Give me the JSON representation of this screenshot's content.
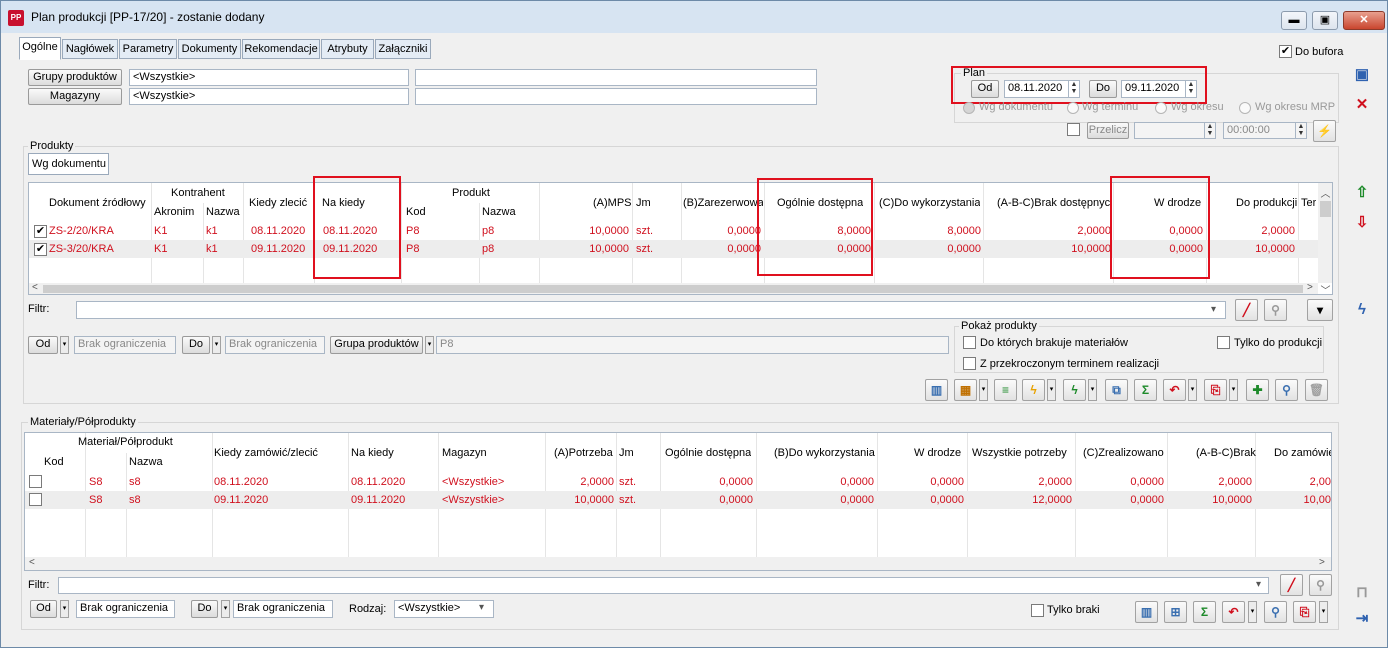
{
  "window": {
    "title": "Plan produkcji [PP-17/20] - zostanie dodany",
    "icon": "PP",
    "min": "▬",
    "max": "▣",
    "close": "✕"
  },
  "tabs": [
    "Ogólne",
    "Nagłówek",
    "Parametry",
    "Dokumenty",
    "Rekomendacje",
    "Atrybuty",
    "Załączniki"
  ],
  "do_bufora": "Do bufora",
  "filters": {
    "grupy_btn": "Grupy produktów",
    "grupy_val": "<Wszystkie>",
    "magazyny_btn": "Magazyny",
    "magazyny_val": "<Wszystkie>"
  },
  "plan": {
    "label": "Plan",
    "od_btn": "Od",
    "od_val": "08.11.2020",
    "do_btn": "Do",
    "do_val": "09.11.2020",
    "radios": [
      "Wg dokumentu",
      "Wg terminu",
      "Wg okresu",
      "Wg okresu MRP"
    ],
    "przelicz": "Przelicz",
    "time": "00:00:00"
  },
  "produkty": {
    "group_label": "Produkty",
    "subtab": "Wg dokumentu",
    "headers": {
      "dok": "Dokument źródłowy",
      "kontrahent": "Kontrahent",
      "akronim": "Akronim",
      "nazwa": "Nazwa",
      "kiedy_zlecic": "Kiedy zlecić",
      "na_kiedy": "Na kiedy",
      "produkt": "Produkt",
      "kod": "Kod",
      "pnazwa": "Nazwa",
      "a_mps": "(A)MPS",
      "jm": "Jm",
      "b_zar": "(B)Zarezerwowana",
      "ogolnie": "Ogólnie dostępna",
      "c_do": "(C)Do wykorzystania",
      "abc_brak": "(A-B-C)Brak dostępnych",
      "w_drodze": "W drodze",
      "do_prod": "Do produkcji",
      "ter": "Ter"
    },
    "rows": [
      {
        "checked": "✔",
        "dok": "ZS-2/20/KRA",
        "akronim": "K1",
        "nazwa": "k1",
        "kiedy": "08.11.2020",
        "na_kiedy": "08.11.2020",
        "kod": "P8",
        "pnazwa": "p8",
        "mps": "10,0000",
        "jm": "szt.",
        "zar": "0,0000",
        "ogolnie": "8,0000",
        "c": "8,0000",
        "brak": "2,0000",
        "wdrodze": "0,0000",
        "doprod": "2,0000"
      },
      {
        "checked": "✔",
        "dok": "ZS-3/20/KRA",
        "akronim": "K1",
        "nazwa": "k1",
        "kiedy": "09.11.2020",
        "na_kiedy": "09.11.2020",
        "kod": "P8",
        "pnazwa": "p8",
        "mps": "10,0000",
        "jm": "szt.",
        "zar": "0,0000",
        "ogolnie": "0,0000",
        "c": "0,0000",
        "brak": "10,0000",
        "wdrodze": "0,0000",
        "doprod": "10,0000"
      }
    ],
    "filtr_label": "Filtr:",
    "od_btn": "Od",
    "od_val": "Brak ograniczenia",
    "do_btn": "Do",
    "do_val": "Brak ograniczenia",
    "grupa_btn": "Grupa produktów",
    "grupa_val": "P8",
    "pokaz": {
      "label": "Pokaż produkty",
      "opt1": "Do których brakuje materiałów",
      "opt2": "Z przekroczonym terminem realizacji",
      "opt3": "Tylko do produkcji"
    }
  },
  "materialy": {
    "group_label": "Materiały/Półprodukty",
    "headers": {
      "matpol": "Materiał/Półprodukt",
      "kod": "Kod",
      "nazwa": "Nazwa",
      "kiedy": "Kiedy zamówić/zlecić",
      "na_kiedy": "Na kiedy",
      "magazyn": "Magazyn",
      "a_potrz": "(A)Potrzeba",
      "jm": "Jm",
      "ogolnie": "Ogólnie dostępna",
      "b_do": "(B)Do wykorzystania",
      "w_drodze": "W drodze",
      "wszystkie": "Wszystkie potrzeby",
      "c_zreal": "(C)Zrealizowano",
      "abc_brak": "(A-B-C)Brak",
      "do_zam": "Do zamówie"
    },
    "rows": [
      {
        "kod": "S8",
        "nazwa": "s8",
        "kiedy": "08.11.2020",
        "na_kiedy": "08.11.2020",
        "magazyn": "<Wszystkie>",
        "potrz": "2,0000",
        "jm": "szt.",
        "ogolnie": "0,0000",
        "b": "0,0000",
        "wdrodze": "0,0000",
        "wszystkie": "2,0000",
        "c": "0,0000",
        "brak": "2,0000",
        "dozam": "2,00"
      },
      {
        "kod": "S8",
        "nazwa": "s8",
        "kiedy": "09.11.2020",
        "na_kiedy": "09.11.2020",
        "magazyn": "<Wszystkie>",
        "potrz": "10,0000",
        "jm": "szt.",
        "ogolnie": "0,0000",
        "b": "0,0000",
        "wdrodze": "0,0000",
        "wszystkie": "12,0000",
        "c": "0,0000",
        "brak": "10,0000",
        "dozam": "10,00"
      }
    ],
    "filtr_label": "Filtr:",
    "od_btn": "Od",
    "od_val": "Brak ograniczenia",
    "do_btn": "Do",
    "do_val": "Brak ograniczenia",
    "rodzaj_label": "Rodzaj:",
    "rodzaj_val": "<Wszystkie>",
    "tylko_braki": "Tylko braki"
  },
  "colors": {
    "red_text": "#d0101e",
    "highlight": "#e0101e",
    "title_bg": "#d7e4f2"
  }
}
